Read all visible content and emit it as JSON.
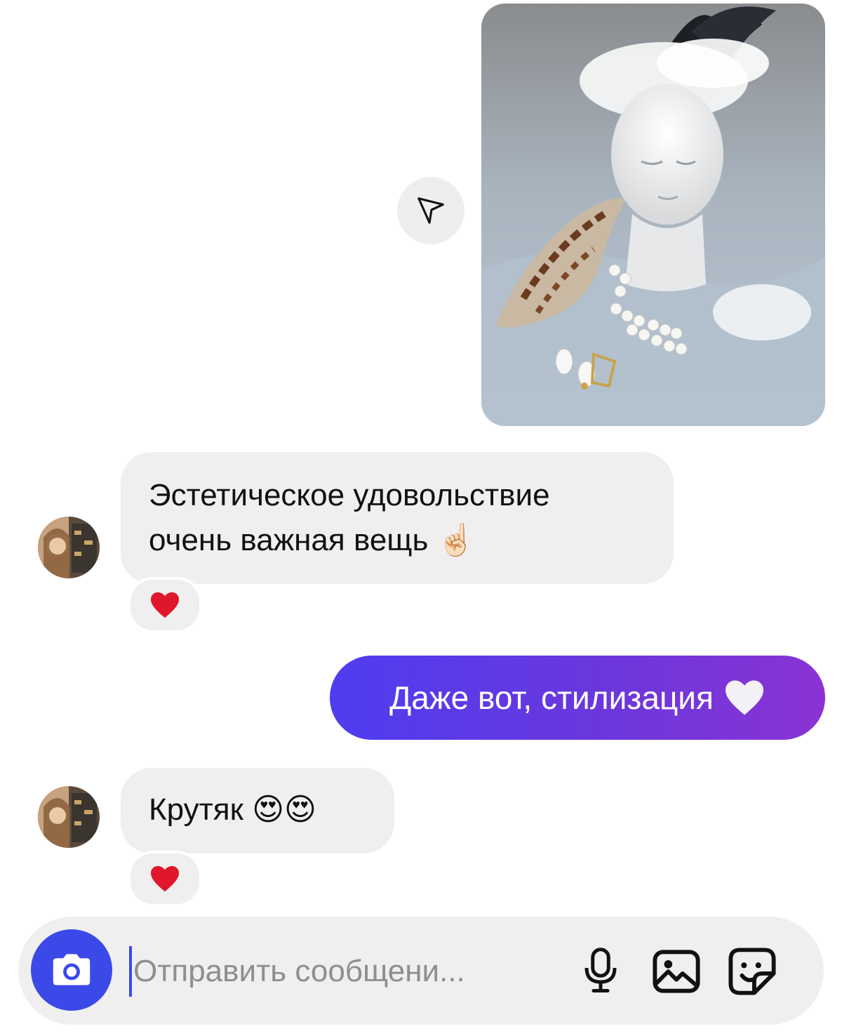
{
  "thread": {
    "shared_photo": {
      "alt": "",
      "share_icon": "send-icon"
    },
    "messages": [
      {
        "from": "them",
        "text_line1": "Эстетическое удовольствие",
        "text_line2": "очень важная вещь",
        "emoji": "☝🏻",
        "reaction": "❤️"
      },
      {
        "from": "me",
        "text": "Даже вот, стилизация",
        "emoji": "🤍"
      },
      {
        "from": "them",
        "text": "Крутяк",
        "emoji": "😍😍",
        "reaction": "❤️"
      }
    ]
  },
  "composer": {
    "placeholder": "Отправить сообщени...",
    "camera_icon": "camera-icon",
    "mic_icon": "microphone-icon",
    "gallery_icon": "image-icon",
    "sticker_icon": "sticker-icon"
  },
  "colors": {
    "sent_bubble_start": "#4e3df0",
    "sent_bubble_end": "#8a33d4",
    "received_bubble": "#efefef",
    "accent": "#3b49e8"
  }
}
